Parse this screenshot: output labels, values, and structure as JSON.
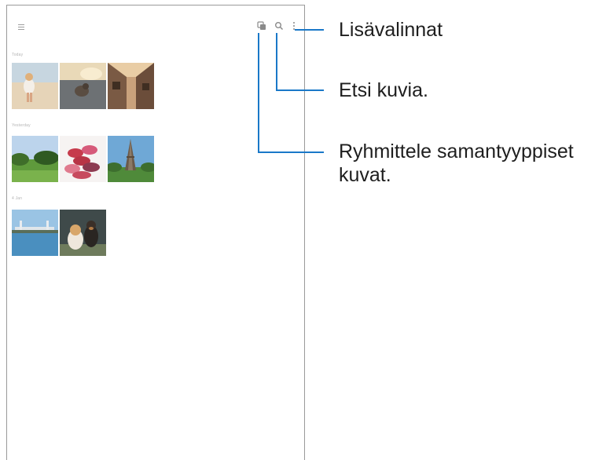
{
  "toolbar": {
    "menu_icon": "hamburger-menu-icon",
    "group_icon": "group-similar-icon",
    "search_icon": "search-icon",
    "more_icon": "more-vertical-icon"
  },
  "sections": [
    {
      "label": "Today",
      "photos": [
        "beach-girl",
        "dog-road",
        "cafe-street"
      ]
    },
    {
      "label": "Yesterday",
      "photos": [
        "green-field",
        "macarons",
        "eiffel-tower"
      ]
    },
    {
      "label": "4 Jan",
      "photos": [
        "harbor-bridge",
        "two-dogs"
      ]
    }
  ],
  "callouts": {
    "more_options": "Lisävalinnat",
    "search": "Etsi kuvia.",
    "group_line1": "Ryhmittele samantyyppiset",
    "group_line2": "kuvat."
  },
  "colors": {
    "callout_line": "#1a78c8",
    "frame": "#9a9a9a"
  }
}
